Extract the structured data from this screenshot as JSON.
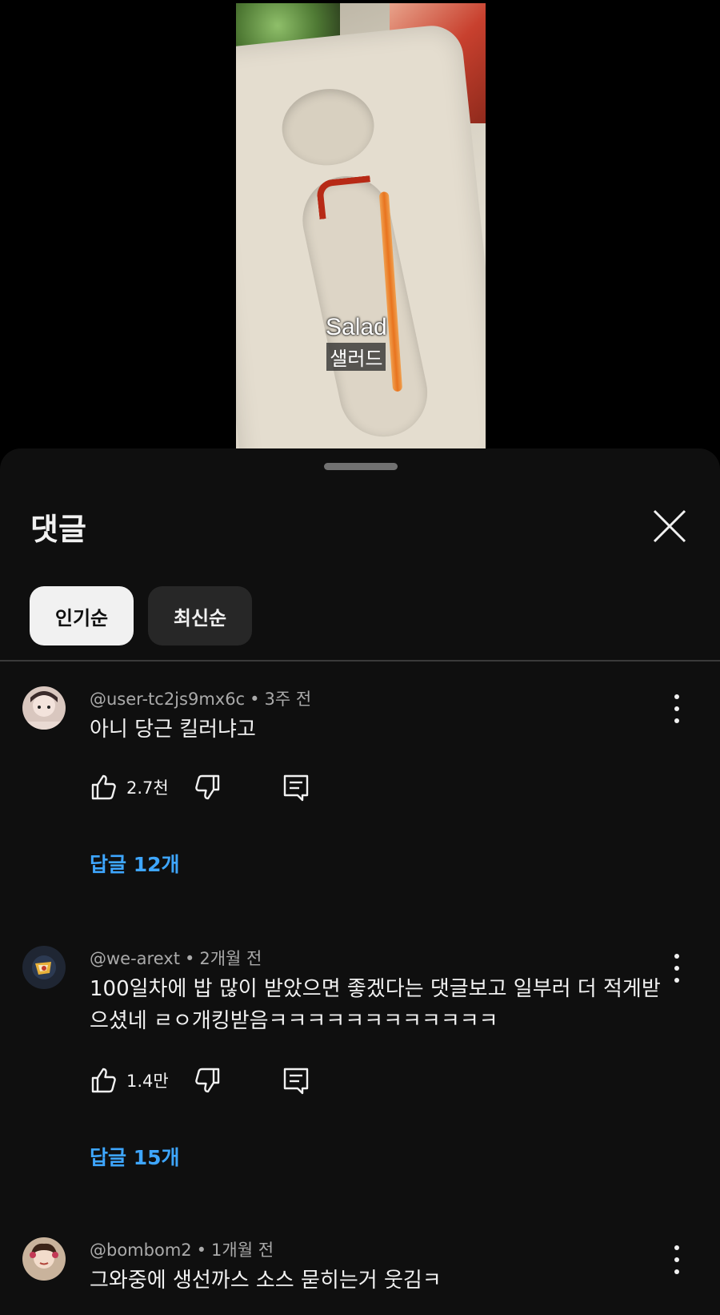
{
  "video": {
    "caption_en": "Salad",
    "caption_ko": "샐러드"
  },
  "sheet": {
    "title": "댓글",
    "close_icon": "close-icon",
    "chips": [
      {
        "label": "인기순",
        "selected": true
      },
      {
        "label": "최신순",
        "selected": false
      }
    ]
  },
  "comments": [
    {
      "author": "@user-tc2js9mx6c",
      "time": "3주 전",
      "text": "아니 당근 킬러냐고",
      "likes": "2.7천",
      "replies": "답글 12개"
    },
    {
      "author": "@we-arext",
      "time": "2개월 전",
      "text": "100일차에 밥 많이 받았으면 좋겠다는 댓글보고 일부러 더 적게받으셨네 ㄹㅇ개킹받음ㅋㅋㅋㅋㅋㅋㅋㅋㅋㅋㅋㅋ",
      "likes": "1.4만",
      "replies": "답글 15개"
    },
    {
      "author": "@bombom2",
      "time": "1개월 전",
      "text": "그와중에 생선까스 소스 묻히는거 웃김ㅋ"
    }
  ],
  "colors": {
    "background": "#0f0f0f",
    "link": "#3ea6ff",
    "chip_selected": "#f1f1f1",
    "chip_default": "#272727"
  }
}
